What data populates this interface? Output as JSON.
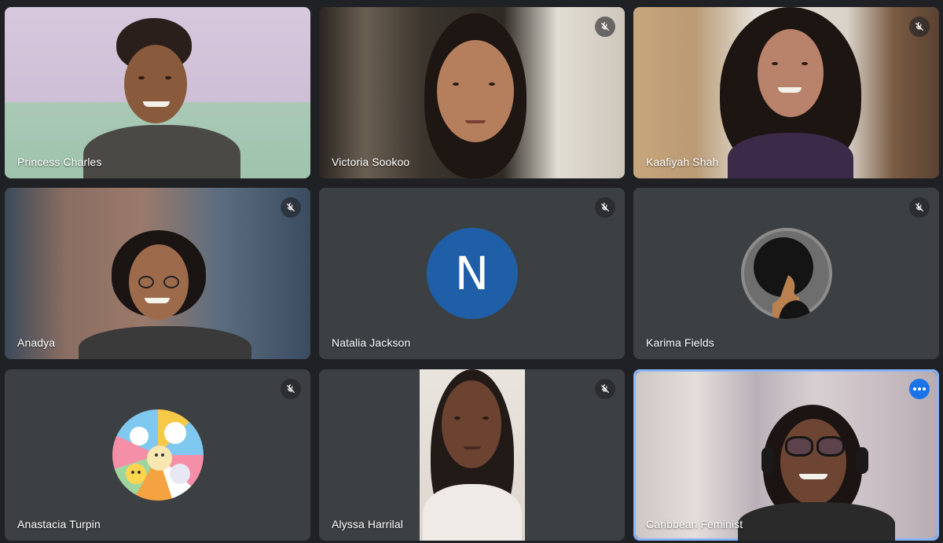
{
  "participants": [
    {
      "name": "Princess Charles",
      "muted": false
    },
    {
      "name": "Victoria Sookoo",
      "muted": true
    },
    {
      "name": "Kaafiyah Shah",
      "muted": true
    },
    {
      "name": "Anadya",
      "muted": true
    },
    {
      "name": "Natalia Jackson",
      "muted": true,
      "avatar_letter": "N",
      "avatar_color": "#1f5fa8"
    },
    {
      "name": "Karima Fields",
      "muted": true
    },
    {
      "name": "Anastacia Turpin",
      "muted": true
    },
    {
      "name": "Alyssa Harrilal",
      "muted": true
    },
    {
      "name": "Caribbean Feminist",
      "muted": false,
      "active_speaker": true
    }
  ],
  "icons": {
    "mute": "mic-off-icon",
    "more": "more-options-icon"
  },
  "colors": {
    "background": "#202124",
    "tile": "#3c4043",
    "active_border": "#8ab4f8",
    "more_button": "#1a73e8"
  }
}
